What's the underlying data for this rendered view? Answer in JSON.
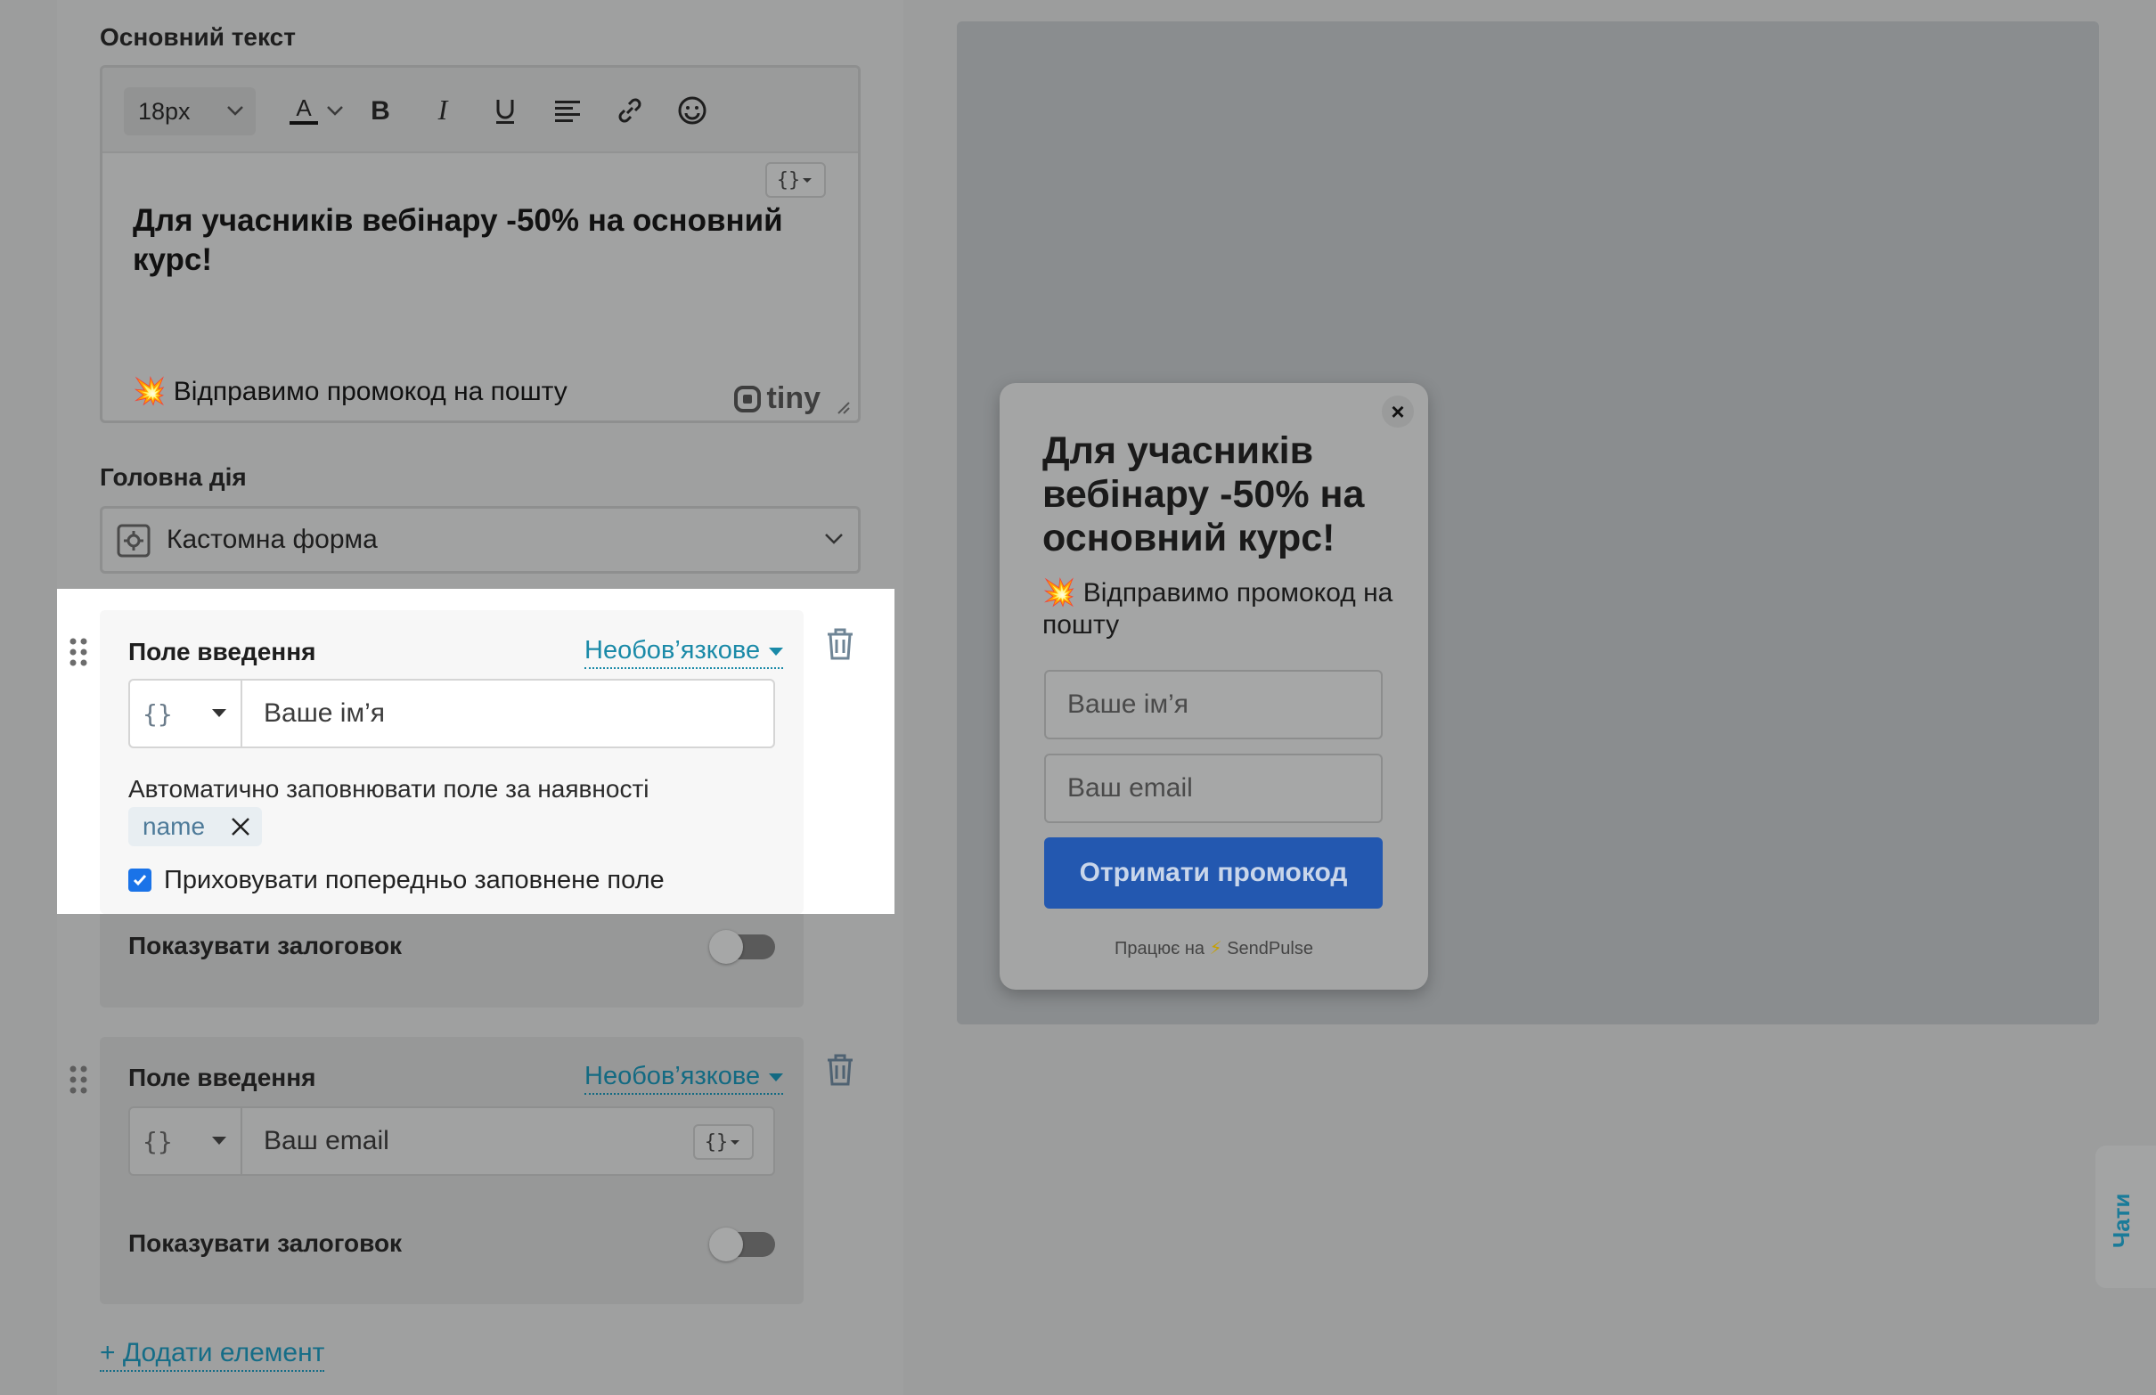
{
  "editor_section": {
    "label": "Основний текст",
    "font_size": "18px",
    "heading": "Для учасників вебінару -50% на основний курс!",
    "subtext": "💥 Відправимо промокод на пошту",
    "tiny_brand": "tiny",
    "var_symbol": "{}"
  },
  "action_section": {
    "label": "Головна дія",
    "selected": "Кастомна форма"
  },
  "fields": [
    {
      "title": "Поле введення",
      "requirement": "Необов’язкове",
      "var_symbol": "{}",
      "placeholder": "Ваше ім’я",
      "autofill_label": "Автоматично заповнювати поле за наявності",
      "autofill_tag": "name",
      "hide_checkbox_label": "Приховувати попередньо заповнене поле",
      "hide_checked": true,
      "show_title_label": "Показувати залоговок",
      "show_title_on": false
    },
    {
      "title": "Поле введення",
      "requirement": "Необов’язкове",
      "var_symbol": "{}",
      "placeholder": "Ваш email",
      "show_title_label": "Показувати залоговок",
      "show_title_on": false
    }
  ],
  "add_element": "+ Додати елемент",
  "popup": {
    "close": "×",
    "title": "Для учасників вебінару -50% на основний курс!",
    "subtext": "💥 Відправимо промокод на пошту",
    "inputs": [
      "Ваше ім’я",
      "Ваш email"
    ],
    "button": "Отримати промокод",
    "powered_prefix": "Працює на",
    "powered_bolt": "⚡",
    "powered_brand": "SendPulse"
  },
  "chat_tab": "Чати",
  "colors": {
    "accent_link": "#1a8aa8",
    "button_blue": "#2358b0",
    "checkbox_blue": "#1a73e8"
  }
}
